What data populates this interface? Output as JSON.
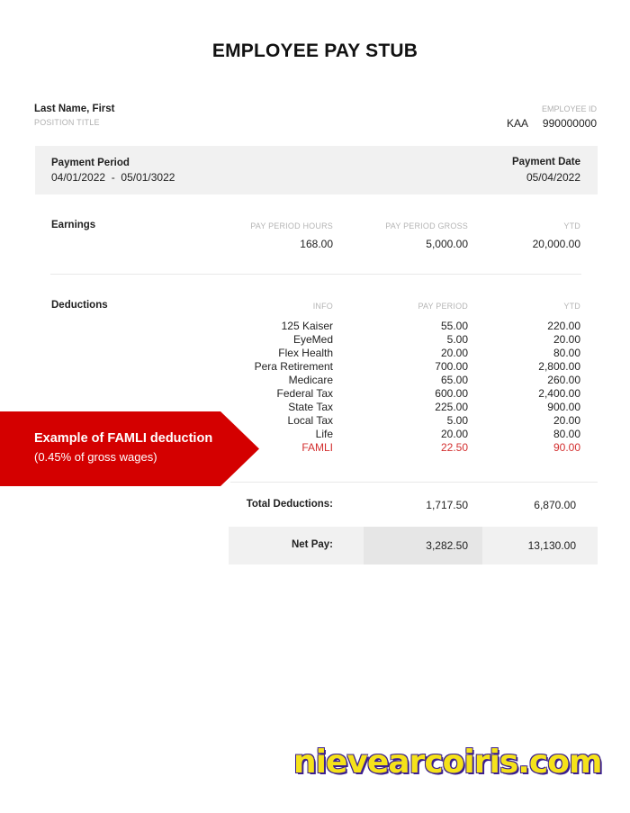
{
  "title": "EMPLOYEE PAY STUB",
  "employee": {
    "name": "Last Name, First",
    "position": "POSITION TITLE",
    "id_label": "EMPLOYEE ID",
    "code": "KAA",
    "id": "990000000"
  },
  "period": {
    "label": "Payment Period",
    "value": "04/01/2022  -  05/01/3022",
    "date_label": "Payment Date",
    "date_value": "05/04/2022"
  },
  "earnings": {
    "label": "Earnings",
    "headers": [
      "PAY PERIOD HOURS",
      "PAY PERIOD GROSS",
      "YTD"
    ],
    "hours": "168.00",
    "gross": "5,000.00",
    "ytd": "20,000.00"
  },
  "deductions": {
    "label": "Deductions",
    "headers": [
      "INFO",
      "PAY PERIOD",
      "YTD"
    ],
    "rows": [
      {
        "info": "125 Kaiser",
        "period": "55.00",
        "ytd": "220.00"
      },
      {
        "info": "EyeMed",
        "period": "5.00",
        "ytd": "20.00"
      },
      {
        "info": "Flex Health",
        "period": "20.00",
        "ytd": "80.00"
      },
      {
        "info": "Pera Retirement",
        "period": "700.00",
        "ytd": "2,800.00"
      },
      {
        "info": "Medicare",
        "period": "65.00",
        "ytd": "260.00"
      },
      {
        "info": "Federal Tax",
        "period": "600.00",
        "ytd": "2,400.00"
      },
      {
        "info": "State Tax",
        "period": "225.00",
        "ytd": "900.00"
      },
      {
        "info": "Local Tax",
        "period": "5.00",
        "ytd": "20.00"
      },
      {
        "info": "Life",
        "period": "20.00",
        "ytd": "80.00"
      },
      {
        "info": "FAMLI",
        "period": "22.50",
        "ytd": "90.00"
      }
    ]
  },
  "totals": {
    "total_label": "Total Deductions:",
    "total_period": "1,717.50",
    "total_ytd": "6,870.00",
    "net_label": "Net Pay:",
    "net_period": "3,282.50",
    "net_ytd": "13,130.00"
  },
  "banner": {
    "line1": "Example of FAMLI deduction",
    "line2": "(0.45% of gross wages)",
    "color": "#d40000"
  },
  "watermark": "nievearcoiris.com",
  "colors": {
    "famli": "#d32f2f",
    "banner": "#d40000"
  }
}
